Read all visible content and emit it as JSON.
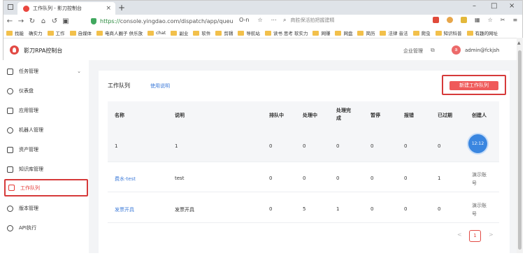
{
  "browser": {
    "tab_title": "工作队列 - 影刀控制台",
    "tab_close": "×",
    "new_tab": "+",
    "url_prefix": "https://",
    "url_rest": "console.yingdao.com/dispatch/app/queu",
    "url_icons": [
      "O-n",
      "☆",
      "⋯"
    ],
    "search_placeholder": "商胜保活拍把握建精",
    "window_controls": [
      "–",
      "□",
      "×"
    ],
    "right_icons": [
      "☆",
      "✂",
      "≡"
    ]
  },
  "bookmarks": [
    "找能",
    "确实力",
    "工作",
    "自媒体",
    "电商人圈子 供乐放",
    "chat",
    "副业",
    "软件",
    "剪辑",
    "导航站",
    "读书 思考 软实力",
    "网赚",
    "网盘",
    "简历",
    "法律 音法",
    "爬虫",
    "知识科普",
    "有趣的网址"
  ],
  "app": {
    "title": "影刀RPA控制台",
    "enterprise": "企业管理",
    "avatar_letter": "a",
    "user": "admin@fckjsh"
  },
  "sidebar": {
    "items": [
      {
        "label": "任务管理",
        "icon": "task-icon",
        "chevron": "⌄"
      },
      {
        "label": "仪表盘",
        "icon": "dashboard-icon"
      },
      {
        "label": "应用管理",
        "icon": "app-icon"
      },
      {
        "label": "机器人管理",
        "icon": "robot-icon"
      },
      {
        "label": "资产管理",
        "icon": "asset-icon"
      },
      {
        "label": "知识库管理",
        "icon": "knowledge-icon"
      },
      {
        "label": "工作队列",
        "icon": "queue-icon"
      },
      {
        "label": "版本管理",
        "icon": "version-icon"
      },
      {
        "label": "API执行",
        "icon": "api-icon"
      }
    ]
  },
  "page": {
    "title": "工作队列",
    "help_link": "使用说明",
    "new_button": "新建工作队列"
  },
  "table": {
    "headers": [
      "名称",
      "说明",
      "排队中",
      "处理中",
      "处理完成",
      "暂停",
      "报错",
      "已过期",
      "创建人"
    ],
    "rows": [
      {
        "name": "1",
        "desc": "1",
        "queued": "0",
        "processing": "0",
        "done": "0",
        "paused": "0",
        "error": "0",
        "expired": "0",
        "creator": "12:12"
      },
      {
        "name": "费水-test",
        "desc": "test",
        "queued": "0",
        "processing": "0",
        "done": "0",
        "paused": "0",
        "error": "0",
        "expired": "1",
        "creator": "演示账号"
      },
      {
        "name": "发票开具",
        "desc": "发票开具",
        "queued": "0",
        "processing": "5",
        "done": "1",
        "paused": "0",
        "error": "0",
        "expired": "0",
        "creator": "演示账号"
      }
    ]
  },
  "pagination": {
    "prev": "<",
    "current": "1",
    "next": ">"
  },
  "colors": {
    "accent": "#e53935",
    "link": "#3d7bd9",
    "button": "#ef5a5a"
  }
}
